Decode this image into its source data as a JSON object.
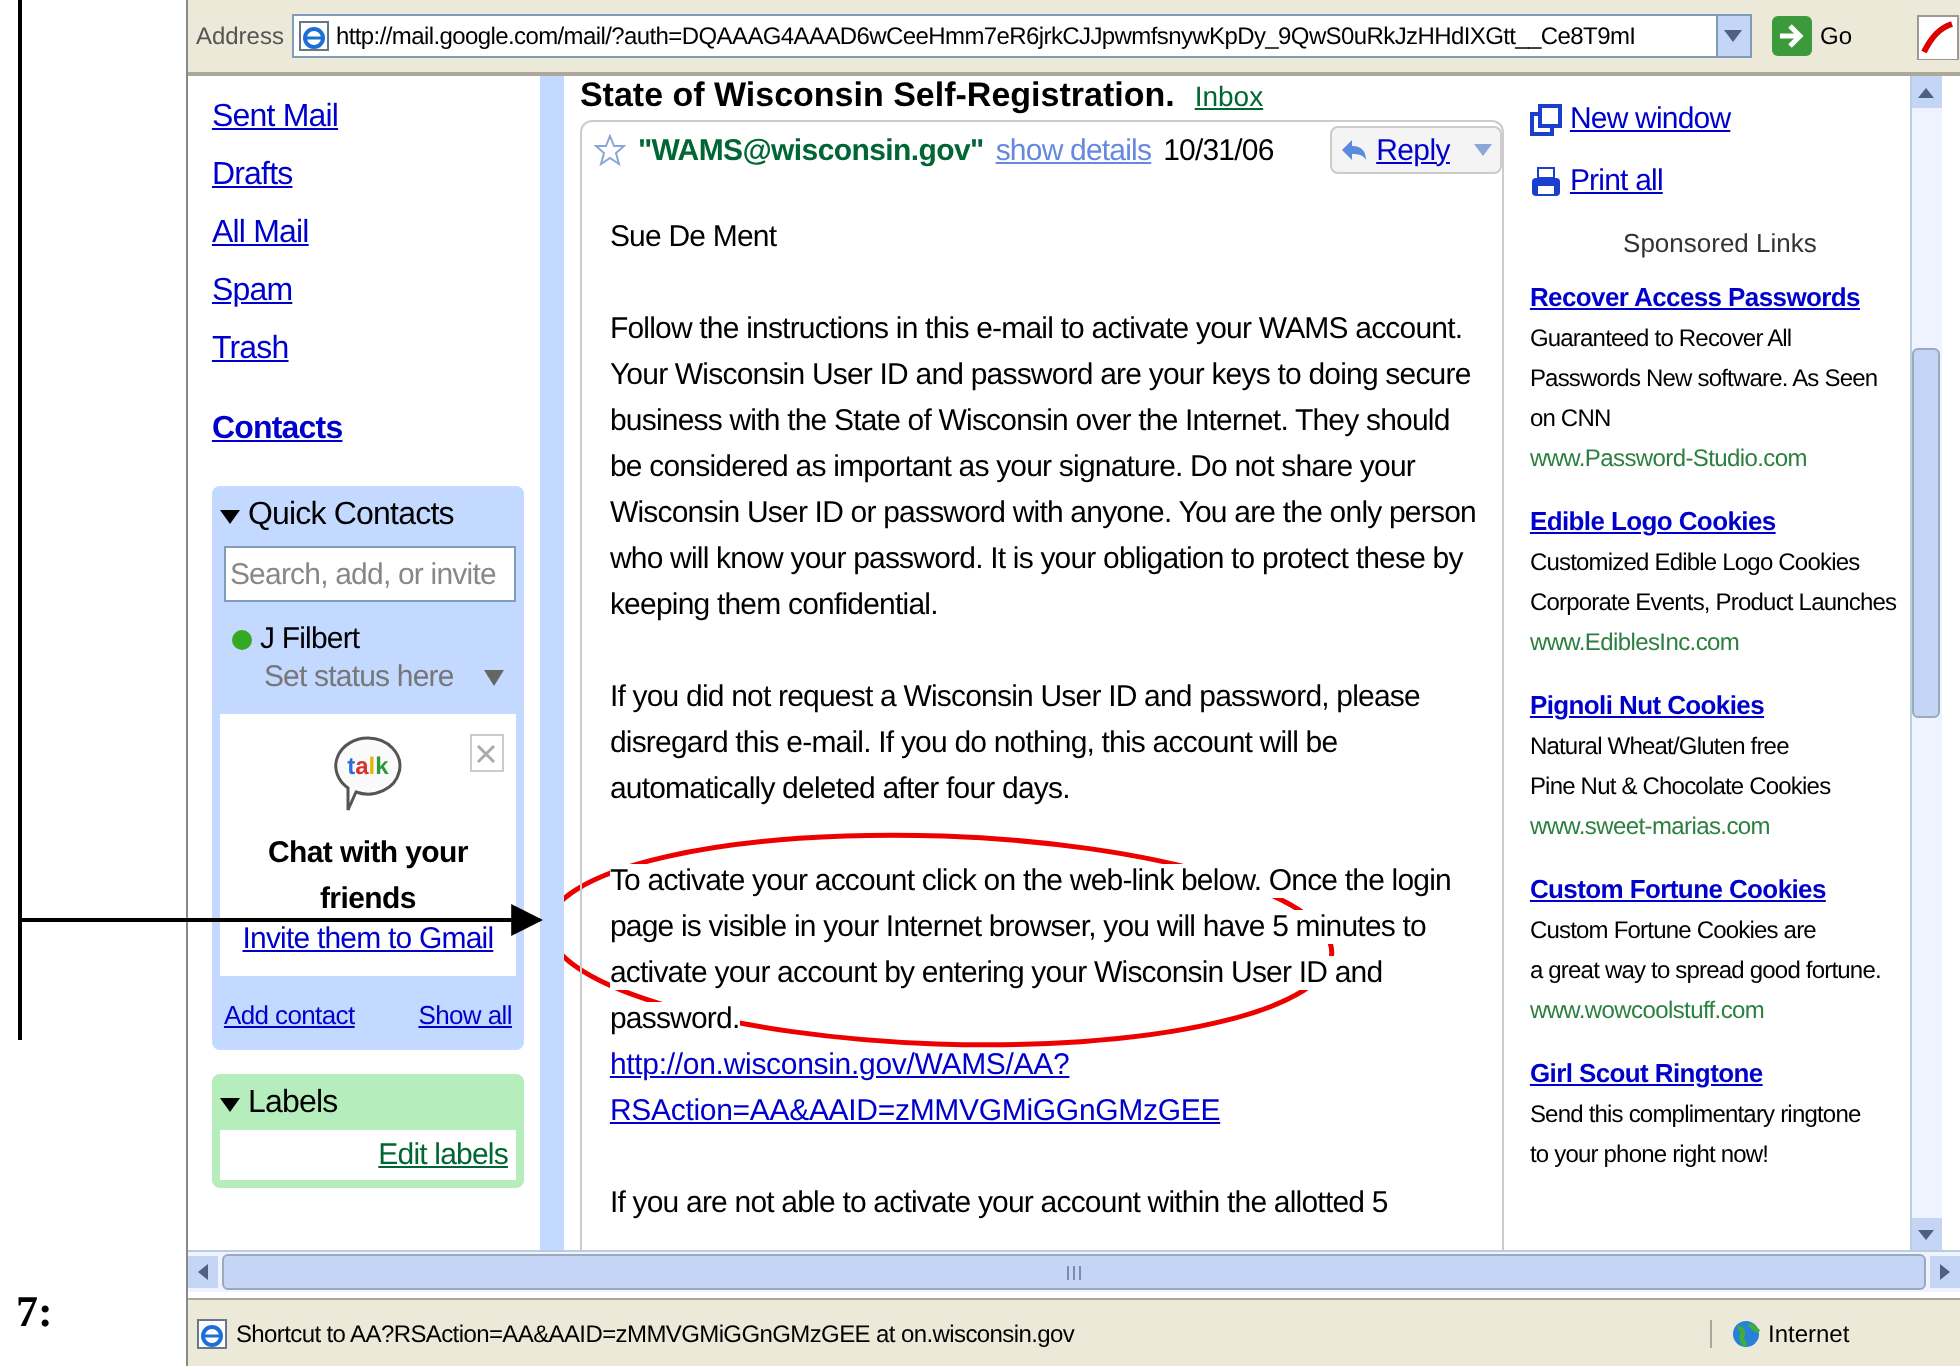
{
  "annotation": {
    "step": "7:"
  },
  "browser": {
    "address_label": "Address",
    "url": "http://mail.google.com/mail/?auth=DQAAAG4AAAD6wCeeHmm7eR6jrkCJJpwmfsnywKpDy_9QwS0uRkJzHHdIXGtt__Ce8T9mI",
    "go": "Go"
  },
  "nav": {
    "links": [
      "Sent Mail",
      "Drafts",
      "All Mail",
      "Spam",
      "Trash"
    ],
    "contacts": "Contacts"
  },
  "quick_contacts": {
    "title": "Quick Contacts",
    "expanded": true,
    "search": {
      "placeholder": "Search, add, or invite"
    },
    "contacts": [
      {
        "name": "J Filbert",
        "online": true,
        "status": "Set status here"
      }
    ],
    "talk": {
      "logo": "talk",
      "heading": "Chat with your friends",
      "invite": "Invite them to Gmail"
    },
    "add_contact": "Add contact",
    "show_all": "Show all"
  },
  "labels": {
    "title": "Labels",
    "expanded": true,
    "edit": "Edit labels"
  },
  "message": {
    "subject": "State of Wisconsin Self-Registration.",
    "label": "Inbox",
    "starred": false,
    "sender": "\"WAMS@wisconsin.gov\"",
    "details": "show details",
    "date": "10/31/06",
    "reply": "Reply",
    "body": [
      {
        "kind": "text",
        "text": "Sue De Ment"
      },
      {
        "kind": "text",
        "text": "Follow the instructions in this e-mail to activate your WAMS account.  Your Wisconsin User ID and password are your keys to doing secure business with the State of Wisconsin over the Internet. They should be considered as important as your signature. Do not share your Wisconsin User ID or password with anyone. You are the only person who will know your password.  It is your obligation to protect these by keeping them confidential."
      },
      {
        "kind": "text",
        "text": "If you did not request a Wisconsin User ID and password, please disregard this e-mail.  If you do nothing, this account will be automatically deleted after four days."
      },
      {
        "kind": "text",
        "text": "To activate your account click on the web-link below.  Once the login page is visible in your Internet browser, you will have 5 minutes to activate your account by entering your Wisconsin User ID and password."
      },
      {
        "kind": "link",
        "lines": [
          "http://on.wisconsin.gov/WAMS/AA?",
          "RSAction=AA&AAID=zMMVGMiGGnGMzGEE"
        ]
      },
      {
        "kind": "text",
        "text": "If you are not able to activate your account within the allotted 5"
      }
    ]
  },
  "side": {
    "new_window": "New window",
    "print_all": "Print all",
    "sponsored": "Sponsored Links",
    "ads": [
      {
        "title": "Recover Access Passwords",
        "lines": [
          "Guaranteed to Recover All",
          "Passwords New software. As Seen",
          "on CNN"
        ],
        "url": "www.Password-Studio.com"
      },
      {
        "title": "Edible Logo Cookies",
        "lines": [
          "Customized Edible Logo Cookies",
          "Corporate Events, Product Launches"
        ],
        "url": "www.EdiblesInc.com"
      },
      {
        "title": "Pignoli Nut Cookies",
        "lines": [
          "Natural Wheat/Gluten free",
          "Pine Nut & Chocolate Cookies"
        ],
        "url": "www.sweet-marias.com"
      },
      {
        "title": "Custom Fortune Cookies",
        "lines": [
          "Custom Fortune Cookies are",
          "a great way to spread good fortune."
        ],
        "url": "www.wowcoolstuff.com"
      },
      {
        "title": "Girl Scout Ringtone",
        "lines": [
          "Send this complimentary ringtone",
          "to your phone right now!"
        ]
      }
    ]
  },
  "status_bar": {
    "text": "Shortcut to AA?RSAction=AA&AAID=zMMVGMiGGnGMzGEE at on.wisconsin.gov",
    "zone": "Internet"
  }
}
